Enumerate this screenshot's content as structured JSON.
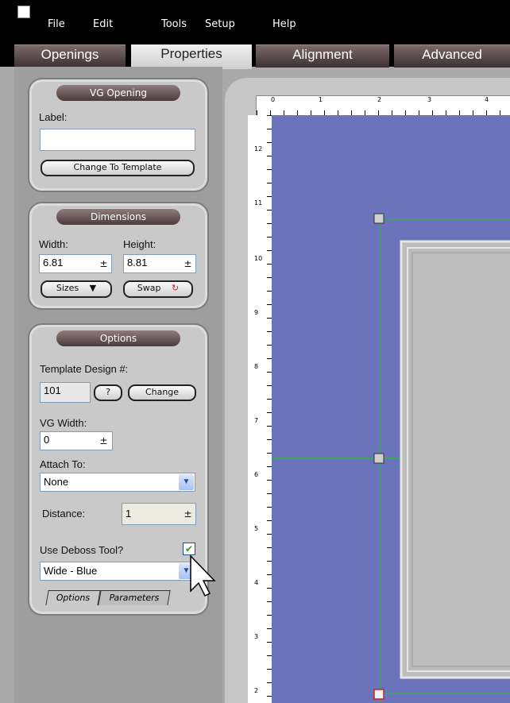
{
  "menubar": {
    "items": [
      "File",
      "Edit",
      "Tools",
      "Setup",
      "Help"
    ]
  },
  "tabs": [
    "Openings",
    "Properties",
    "Alignment",
    "Advanced"
  ],
  "vg_opening": {
    "title": "VG Opening",
    "label_caption": "Label:",
    "label_value": "",
    "change_template_button": "Change To Template"
  },
  "dimensions": {
    "title": "Dimensions",
    "width_label": "Width:",
    "height_label": "Height:",
    "width_value": "6.81",
    "height_value": "8.81",
    "sizes_button": "Sizes",
    "swap_button": "Swap"
  },
  "options": {
    "title": "Options",
    "template_design_label": "Template Design #:",
    "template_design_value": "101",
    "help_button": "?",
    "change_button": "Change",
    "vg_width_label": "VG Width:",
    "vg_width_value": "0",
    "attach_label": "Attach To:",
    "attach_value": "None",
    "distance_label": "Distance:",
    "distance_value": "1",
    "deboss_label": "Use Deboss Tool?",
    "deboss_checked": true,
    "deboss_style_value": "Wide - Blue",
    "subtab_options": "Options",
    "subtab_parameters": "Parameters"
  },
  "ruler": {
    "top_labels": [
      "0",
      "1",
      "2",
      "3",
      "4"
    ],
    "left_labels": [
      "12",
      "11",
      "10",
      "9",
      "8",
      "7",
      "6",
      "5",
      "4",
      "3",
      "2"
    ]
  },
  "colors": {
    "canvas_blue": "#6b73bb",
    "guide_green": "#3aa65a",
    "tab_dark": "#5a4a4c"
  }
}
